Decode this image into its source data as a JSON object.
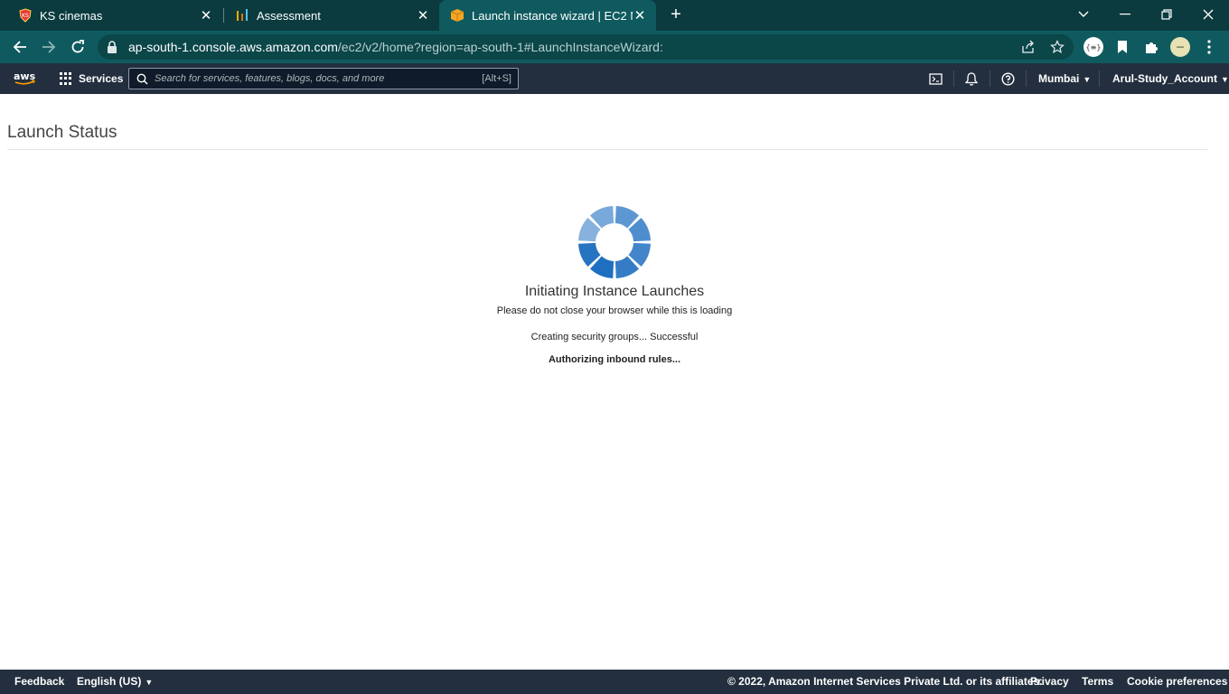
{
  "browser": {
    "tabs": [
      {
        "title": "KS cinemas",
        "icon": "ks-cinemas-favicon"
      },
      {
        "title": "Assessment",
        "icon": "assessment-chart-favicon"
      },
      {
        "title": "Launch instance wizard | EC2 Ma",
        "icon": "aws-box-favicon"
      }
    ],
    "url_host": "ap-south-1.console.aws.amazon.com",
    "url_path": "/ec2/v2/home?region=ap-south-1#LaunchInstanceWizard:"
  },
  "aws_nav": {
    "services_label": "Services",
    "search_placeholder": "Search for services, features, blogs, docs, and more",
    "search_shortcut": "[Alt+S]",
    "region": "Mumbai",
    "account": "Arul-Study_Account"
  },
  "main": {
    "title": "Launch Status",
    "status_title": "Initiating Instance Launches",
    "status_subtitle": "Please do not close your browser while this is loading",
    "step_security_groups": "Creating security groups... Successful",
    "step_inbound_rules": "Authorizing inbound rules..."
  },
  "footer": {
    "feedback": "Feedback",
    "language": "English (US)",
    "copyright": "© 2022, Amazon Internet Services Private Ltd. or its affiliates.",
    "privacy": "Privacy",
    "terms": "Terms",
    "cookies": "Cookie preferences"
  },
  "colors": {
    "tabstrip": "#0b3b3f",
    "toolbar": "#0f5a5f",
    "aws_nav": "#232f3e",
    "spinner_dark": "#1f6fc0",
    "spinner_light": "#a9c8e8"
  }
}
